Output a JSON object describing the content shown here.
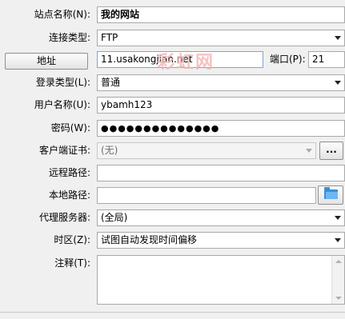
{
  "fields": {
    "site_name": {
      "label": "站点名称(N):",
      "value": "我的网站"
    },
    "conn_type": {
      "label": "连接类型:",
      "value": "FTP"
    },
    "address": {
      "button": "地址",
      "value": "11.usakongjian.net"
    },
    "port": {
      "label": "端口(P):",
      "value": "21"
    },
    "login_type": {
      "label": "登录类型(L):",
      "value": "普通"
    },
    "username": {
      "label": "用户名称(U):",
      "value": "ybamh123"
    },
    "password": {
      "label": "密码(W):",
      "value": "●●●●●●●●●●●●●●"
    },
    "client_cert": {
      "label": "客户端证书:",
      "value": "(无)",
      "button": "..."
    },
    "remote_path": {
      "label": "远程路径:",
      "value": ""
    },
    "local_path": {
      "label": "本地路径:",
      "value": ""
    },
    "proxy": {
      "label": "代理服务器:",
      "value": "(全局)"
    },
    "timezone": {
      "label": "时区(Z):",
      "value": "试图自动发现时间偏移"
    },
    "notes": {
      "label": "注释(T):",
      "value": ""
    }
  },
  "watermark": "彩虹网",
  "icons": {
    "dropdown": "chevron-down-icon",
    "browse": "folder-icon"
  },
  "colors": {
    "folder": "#3a8fd6",
    "watermark": "#f3b3b3"
  }
}
